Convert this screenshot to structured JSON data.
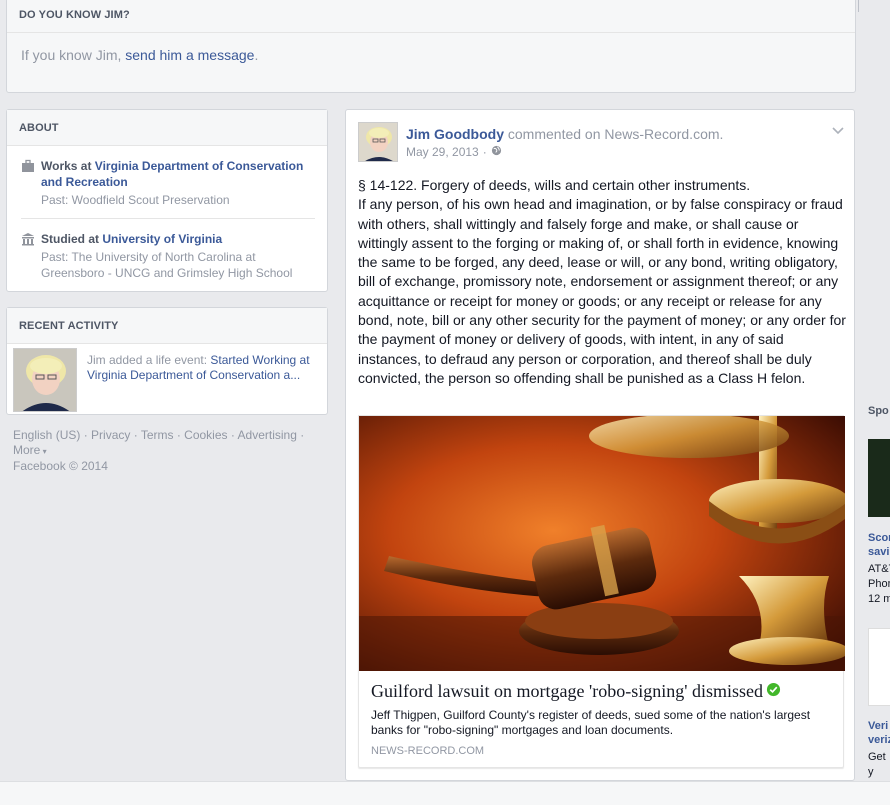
{
  "know_card": {
    "header": "Do you know Jim?",
    "text_prefix": "If you know Jim, ",
    "link": "send him a message",
    "text_suffix": "."
  },
  "about": {
    "header": "About",
    "work": {
      "prefix": "Works at ",
      "link": "Virginia Department of Conservation and Recreation",
      "past": "Past: Woodfield Scout Preservation"
    },
    "education": {
      "prefix": "Studied at ",
      "link": "University of Virginia",
      "past": "Past: The University of North Carolina at Greensboro - UNCG and Grimsley High School"
    }
  },
  "recent": {
    "header": "Recent Activity",
    "text_prefix": "Jim added a life event: ",
    "link": "Started Working at Virginia Department of Conservation a..."
  },
  "footer": {
    "links": [
      "English (US)",
      "Privacy",
      "Terms",
      "Cookies",
      "Advertising",
      "More"
    ],
    "copyright": "Facebook © 2014"
  },
  "post": {
    "author": "Jim Goodbody",
    "action": " commented on News-Record.com.",
    "date": "May 29, 2013",
    "body": "§ 14-122. Forgery of deeds, wills and certain other instruments.\nIf any person, of his own head and imagination, or by false conspiracy or fraud with others, shall wittingly and falsely forge and make, or shall cause or wittingly assent to the forging or making of, or shall forth in evidence, knowing the same to be forged, any deed, lease or will, or any bond, writing obligatory, bill of exchange, promissory note, endorsement or assignment thereof; or any acquittance or receipt for money or goods; or any receipt or release for any bond, note, bill or any other security for the payment of money; or any order for the payment of money or delivery of goods, with intent, in any of said instances, to defraud any person or corporation, and thereof shall be duly convicted, the person so offending shall be punished as a Class H felon.",
    "link_title": "Guilford lawsuit on mortgage 'robo-signing' dismissed",
    "link_desc": "Jeff Thigpen, Guilford County's register of deeds, sued some of the nation's largest banks for \"robo-signing\" mortgages and loan documents.",
    "link_source": "NEWS-RECORD.COM"
  },
  "sidebar": {
    "sponsored": "Spo",
    "ad1_title": "Scor\nsavi",
    "ad1_sub": "AT&T\nPhon\n12 m",
    "ad2_title": "Veri\nveriz",
    "ad2_sub": "Get y\nPow"
  },
  "colors": {
    "link": "#3b5998",
    "muted": "#9197a3",
    "background": "#e9eaed",
    "verified": "#42b72a"
  }
}
